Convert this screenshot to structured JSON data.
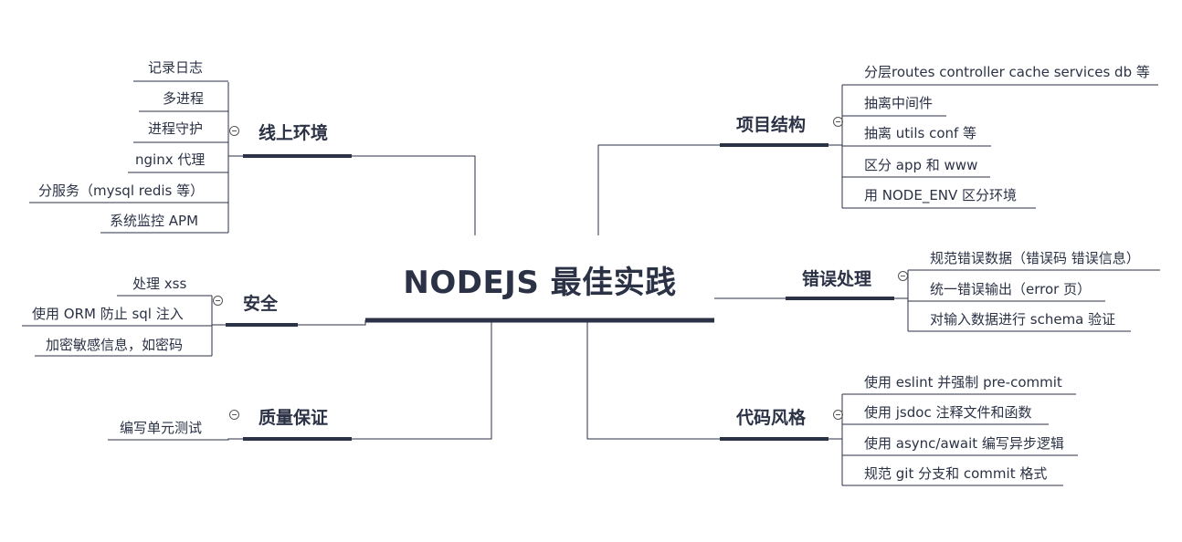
{
  "root": {
    "title": "NODEJS 最佳实践"
  },
  "branches": {
    "online_env": {
      "label": "线上环境",
      "items": [
        "记录日志",
        "多进程",
        "进程守护",
        "nginx 代理",
        "分服务（mysql redis 等）",
        "系统监控 APM"
      ]
    },
    "security": {
      "label": "安全",
      "items": [
        "处理 xss",
        "使用 ORM 防止 sql 注入",
        "加密敏感信息，如密码"
      ]
    },
    "quality": {
      "label": "质量保证",
      "items": [
        "编写单元测试"
      ]
    },
    "project_structure": {
      "label": "项目结构",
      "items": [
        "分层routes controller cache services db 等",
        "抽离中间件",
        "抽离 utils conf 等",
        "区分 app 和 www",
        "用 NODE_ENV 区分环境"
      ]
    },
    "error_handling": {
      "label": "错误处理",
      "items": [
        "规范错误数据（错误码 错误信息）",
        "统一错误输出（error 页）",
        "对输入数据进行 schema 验证"
      ]
    },
    "code_style": {
      "label": "代码风格",
      "items": [
        "使用 eslint 并强制 pre-commit",
        "使用 jsdoc 注释文件和函数",
        "使用 async/await 编写异步逻辑",
        "规范 git 分支和 commit 格式"
      ]
    }
  },
  "colors": {
    "line": "#2b3245",
    "text": "#2b3245"
  }
}
